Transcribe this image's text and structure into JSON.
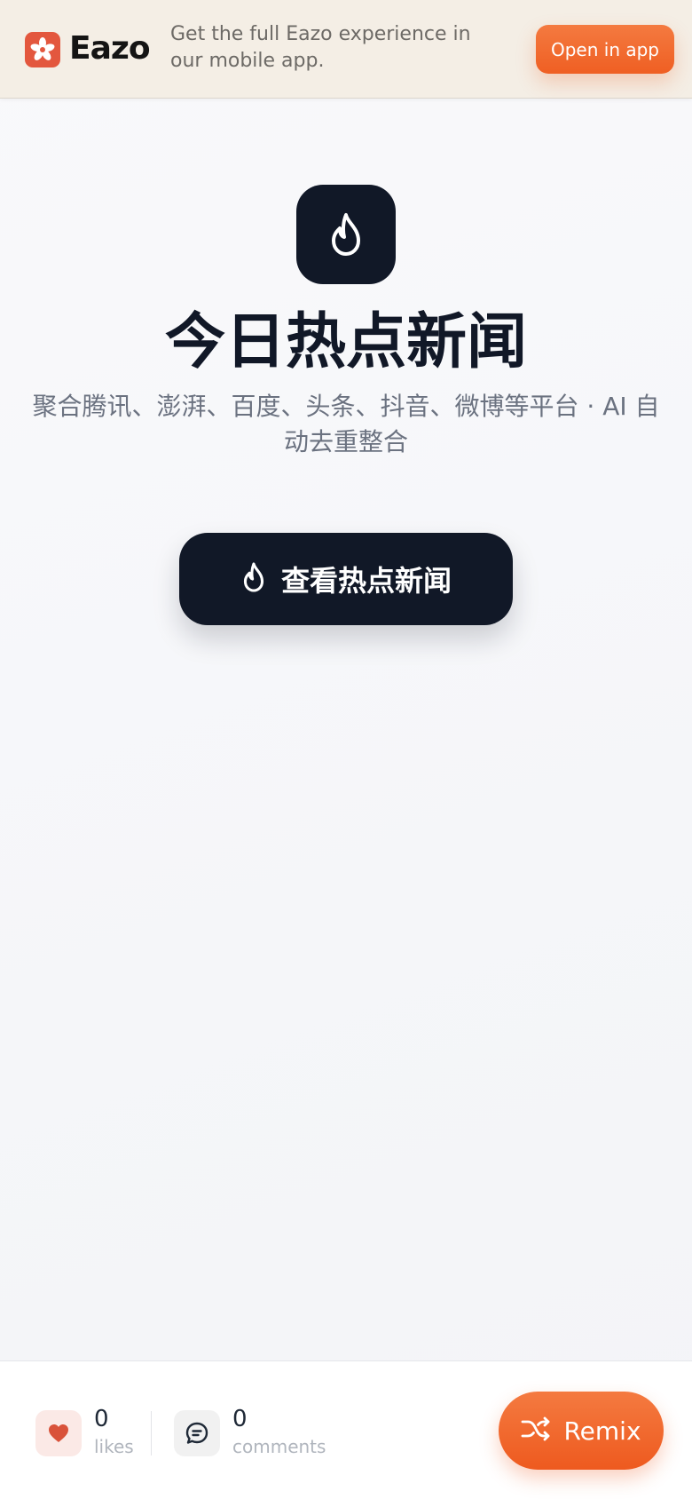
{
  "banner": {
    "brand": "Eazo",
    "message": "Get the full Eazo experience in our mobile app.",
    "open_label": "Open in app",
    "accent": "#ef5f23"
  },
  "hero": {
    "icon": "flame-icon",
    "title": "今日热点新闻",
    "subtitle": "聚合腾讯、澎湃、百度、头条、抖音、微博等平台 · AI 自动去重整合",
    "cta_label": "查看热点新闻",
    "cta_icon": "flame-icon"
  },
  "footer": {
    "likes_count": "0",
    "likes_label": "likes",
    "comments_count": "0",
    "comments_label": "comments",
    "remix_label": "Remix",
    "remix_icon": "shuffle-icon"
  }
}
